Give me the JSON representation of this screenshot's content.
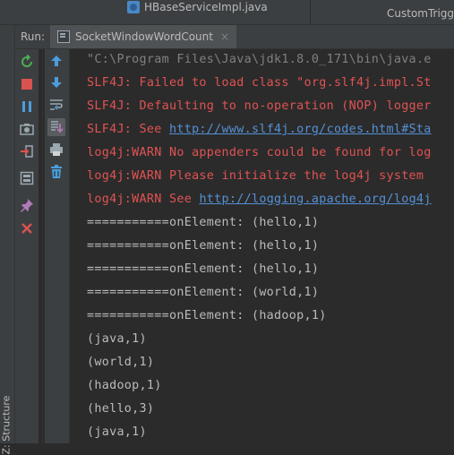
{
  "editor_tabs": [
    {
      "label": "HBaseServiceImpl.java"
    },
    {
      "label": "CustomTrigg"
    }
  ],
  "run": {
    "label": "Run:",
    "config_tab": "SocketWindowWordCount",
    "close_symbol": "×"
  },
  "sidebar": {
    "structure_label": "Z: Structure"
  },
  "toolbar_left": [
    {
      "icon": "rerun-icon",
      "color": "#4caf50"
    },
    {
      "icon": "stop-icon",
      "color": "#d9534f"
    },
    {
      "icon": "pause-icon",
      "color": "#4a9edd"
    },
    {
      "icon": "dump-threads-icon",
      "color": "#9aa7b0"
    },
    {
      "icon": "exit-icon",
      "color": "#d9534f"
    },
    {
      "icon": "layout-icon",
      "color": "#9aa7b0"
    },
    {
      "icon": "pin-icon",
      "color": "#b07ab8"
    },
    {
      "icon": "close-icon",
      "color": "#d9534f"
    }
  ],
  "toolbar_right": [
    {
      "icon": "up-arrow-icon",
      "color": "#4a9edd"
    },
    {
      "icon": "down-arrow-icon",
      "color": "#4a9edd"
    },
    {
      "icon": "soft-wrap-icon",
      "color": "#9aa7b0"
    },
    {
      "icon": "scroll-to-end-icon",
      "color": "#9aa7b0"
    },
    {
      "icon": "print-icon",
      "color": "#9aa7b0"
    },
    {
      "icon": "clear-all-icon",
      "color": "#4a9edd"
    }
  ],
  "console": {
    "lines": [
      {
        "kind": "cmd",
        "text": "\"C:\\Program Files\\Java\\jdk1.8.0_171\\bin\\java.e"
      },
      {
        "kind": "error",
        "text": "SLF4J: Failed to load class \"org.slf4j.impl.St"
      },
      {
        "kind": "error",
        "text": "SLF4J: Defaulting to no-operation (NOP) logger"
      },
      {
        "kind": "error",
        "prefix": "SLF4J: See ",
        "link": "http://www.slf4j.org/codes.html#Sta"
      },
      {
        "kind": "error",
        "text": "log4j:WARN No appenders could be found for log"
      },
      {
        "kind": "error",
        "text": "log4j:WARN Please initialize the log4j system"
      },
      {
        "kind": "error",
        "prefix": "log4j:WARN See ",
        "link": "http://logging.apache.org/log4j"
      },
      {
        "kind": "out",
        "text": "===========onElement: (hello,1)"
      },
      {
        "kind": "out",
        "text": "===========onElement: (hello,1)"
      },
      {
        "kind": "out",
        "text": "===========onElement: (hello,1)"
      },
      {
        "kind": "out",
        "text": "===========onElement: (world,1)"
      },
      {
        "kind": "out",
        "text": "===========onElement: (hadoop,1)"
      },
      {
        "kind": "out",
        "text": "(java,1)"
      },
      {
        "kind": "out",
        "text": "(world,1)"
      },
      {
        "kind": "out",
        "text": "(hadoop,1)"
      },
      {
        "kind": "out",
        "text": "(hello,3)"
      },
      {
        "kind": "out",
        "text": "(java,1)"
      }
    ]
  }
}
